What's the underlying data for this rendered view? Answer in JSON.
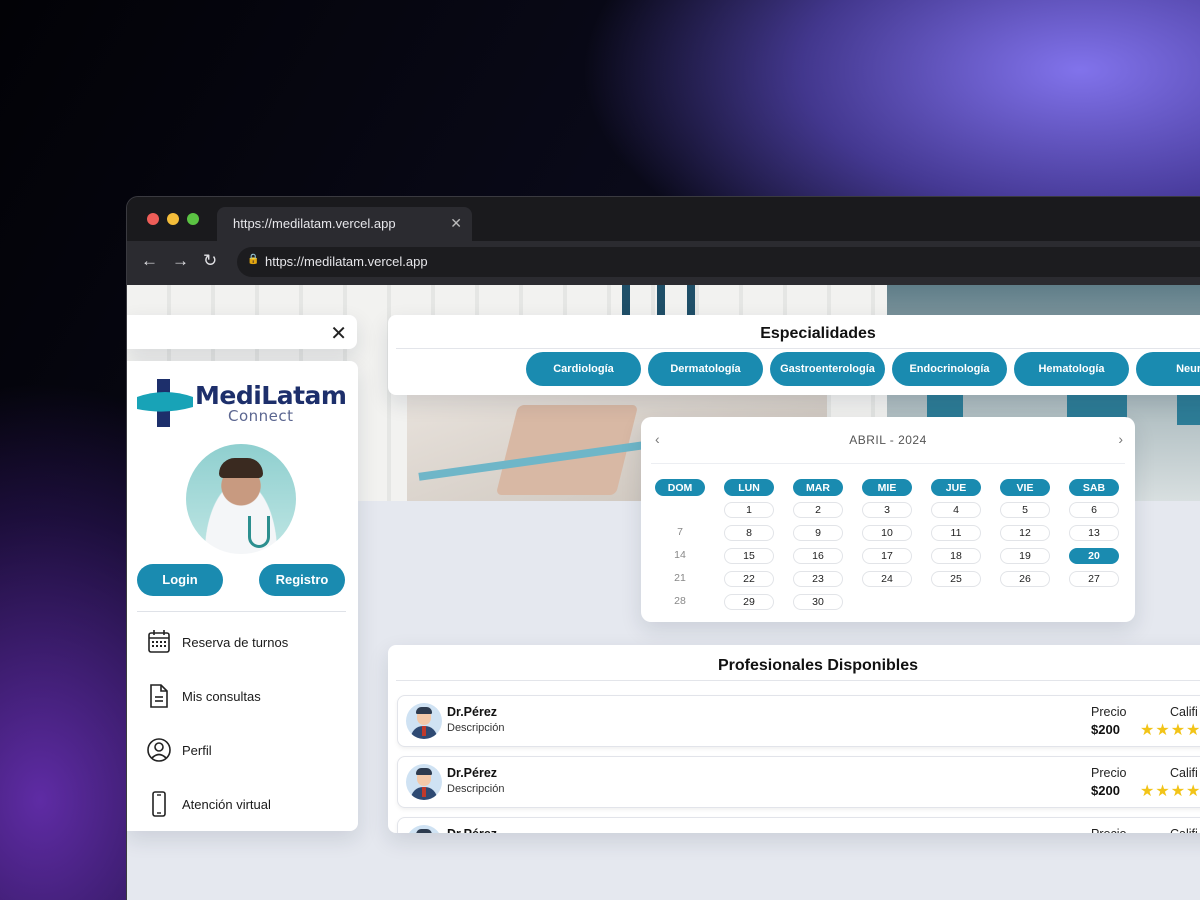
{
  "browser": {
    "tab_title": "https://medilatam.vercel.app",
    "url": "https://medilatam.vercel.app",
    "tab_close": "✕",
    "back": "←",
    "forward": "→",
    "reload": "↻"
  },
  "sidebar": {
    "close_icon": "✕",
    "logo_name": "MediLatam",
    "logo_sub": "Connect",
    "login_label": "Login",
    "registro_label": "Registro",
    "menu": [
      {
        "label": "Reserva de turnos",
        "icon": "calendar-icon"
      },
      {
        "label": "Mis consultas",
        "icon": "document-icon"
      },
      {
        "label": "Perfil",
        "icon": "user-icon"
      },
      {
        "label": "Atención virtual",
        "icon": "phone-icon"
      }
    ]
  },
  "especialidades": {
    "title": "Especialidades",
    "items": [
      "Cardiología",
      "Dermatología",
      "Gastroenterología",
      "Endocrinología",
      "Hematología",
      "Neurol"
    ]
  },
  "calendar": {
    "month_label": "ABRIL - 2024",
    "prev": "‹",
    "next": "›",
    "weekdays": [
      "DOM",
      "LUN",
      "MAR",
      "MIE",
      "JUE",
      "VIE",
      "SAB"
    ],
    "weeks": [
      [
        "",
        "1",
        "2",
        "3",
        "4",
        "5",
        "6"
      ],
      [
        "7",
        "8",
        "9",
        "10",
        "11",
        "12",
        "13"
      ],
      [
        "14",
        "15",
        "16",
        "17",
        "18",
        "19",
        "20"
      ],
      [
        "21",
        "22",
        "23",
        "24",
        "25",
        "26",
        "27"
      ],
      [
        "28",
        "29",
        "30",
        "",
        "",
        "",
        ""
      ]
    ],
    "selected_day": "20"
  },
  "profesionales": {
    "title": "Profesionales Disponibles",
    "price_label": "Precio",
    "rating_label": "Califi",
    "rows": [
      {
        "name": "Dr.Pérez",
        "description": "Descripción",
        "price": "$200",
        "stars": "★★★★"
      },
      {
        "name": "Dr.Pérez",
        "description": "Descripción",
        "price": "$200",
        "stars": "★★★★"
      },
      {
        "name": "Dr.Pérez",
        "description": "",
        "price": "",
        "stars": ""
      }
    ]
  },
  "colors": {
    "accent": "#1a8bb0",
    "brand_navy": "#1d2f6b",
    "brand_teal": "#18a3b7",
    "star": "#f2c418"
  }
}
